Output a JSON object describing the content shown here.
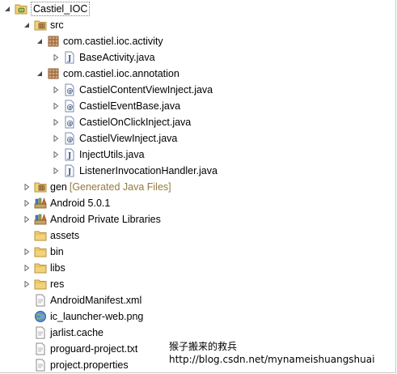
{
  "tree": {
    "root": {
      "label": "Castiel_IOC"
    },
    "src": {
      "label": "src"
    },
    "pkg_activity": {
      "label": "com.castiel.ioc.activity"
    },
    "file_baseactivity": {
      "label": "BaseActivity.java"
    },
    "pkg_annotation": {
      "label": "com.castiel.ioc.annotation"
    },
    "file_contentviewinject": {
      "label": "CastielContentViewInject.java"
    },
    "file_eventbase": {
      "label": "CastielEventBase.java"
    },
    "file_onclickinject": {
      "label": "CastielOnClickInject.java"
    },
    "file_viewinject": {
      "label": "CastielViewInject.java"
    },
    "file_injectutils": {
      "label": "InjectUtils.java"
    },
    "file_listenerhandler": {
      "label": "ListenerInvocationHandler.java"
    },
    "gen": {
      "label": "gen",
      "decoration": "[Generated Java Files]"
    },
    "android": {
      "label": "Android 5.0.1"
    },
    "private_libs": {
      "label": "Android Private Libraries"
    },
    "assets": {
      "label": "assets"
    },
    "bin": {
      "label": "bin"
    },
    "libs": {
      "label": "libs"
    },
    "res": {
      "label": "res"
    },
    "manifest": {
      "label": "AndroidManifest.xml"
    },
    "launcher": {
      "label": "ic_launcher-web.png"
    },
    "jarlist": {
      "label": "jarlist.cache"
    },
    "proguard": {
      "label": "proguard-project.txt"
    },
    "properties": {
      "label": "project.properties"
    }
  },
  "watermark": {
    "line1": "猴子搬来的救兵",
    "line2": "http://blog.csdn.net/mynameishuangshuai"
  },
  "colors": {
    "decoration": "#937a42",
    "folder": "#e8c86a",
    "package": "#a0704a",
    "java": "#5b6fa8"
  }
}
